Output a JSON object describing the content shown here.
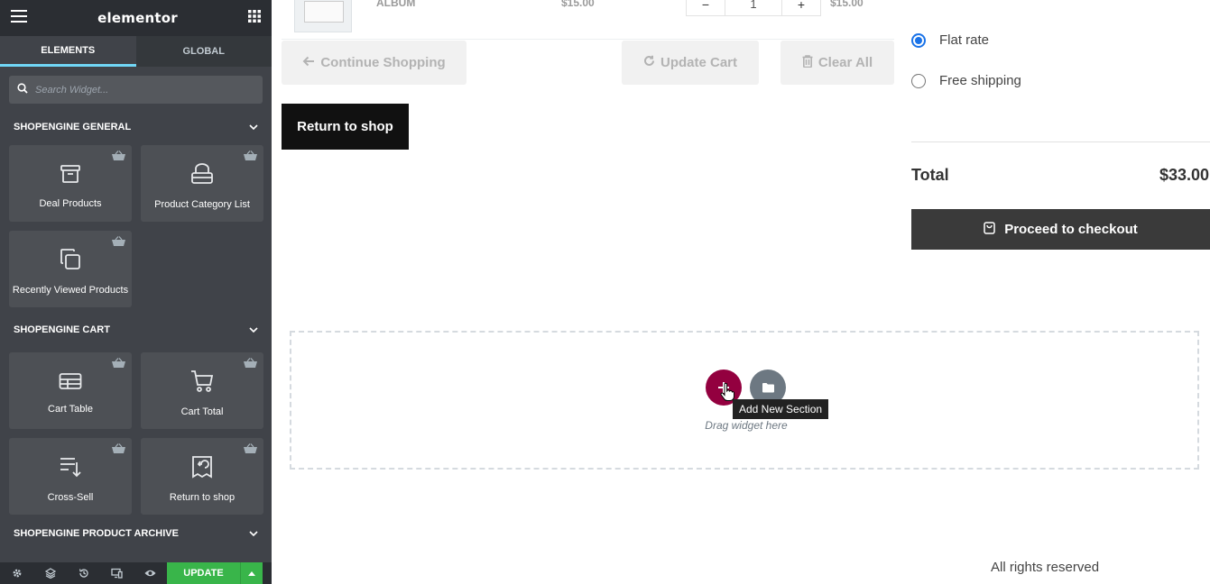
{
  "editor": {
    "logo": "elementor",
    "tabs": [
      "ELEMENTS",
      "GLOBAL"
    ],
    "search_placeholder": "Search Widget...",
    "categories": {
      "general": "SHOPENGINE GENERAL",
      "cart": "SHOPENGINE CART",
      "archive": "SHOPENGINE PRODUCT ARCHIVE"
    },
    "general_widgets": [
      "Deal Products",
      "Product Category List",
      "Recently Viewed Products"
    ],
    "cart_widgets": [
      "Cart Table",
      "Cart Total",
      "Cross-Sell",
      "Return to shop"
    ],
    "update_label": "UPDATE",
    "accent_color": "#39b54a"
  },
  "cart": {
    "row": {
      "product": "ALBUM",
      "price": "$15.00",
      "minus": "−",
      "qty": "1",
      "plus": "+",
      "subtotal": "$15.00"
    },
    "continue_label": "Continue Shopping",
    "update_label": "Update Cart",
    "clear_label": "Clear All",
    "return_label": "Return to shop"
  },
  "totals": {
    "shipping_options": [
      "Flat rate",
      "Free shipping"
    ],
    "selected_shipping": "Flat rate",
    "total_label": "Total",
    "total_value": "$33.00",
    "checkout_label": "Proceed to checkout"
  },
  "dropzone": {
    "hint": "Drag widget here",
    "tooltip": "Add New Section",
    "add_color": "#93003f"
  },
  "footer": {
    "text": "All rights reserved"
  }
}
